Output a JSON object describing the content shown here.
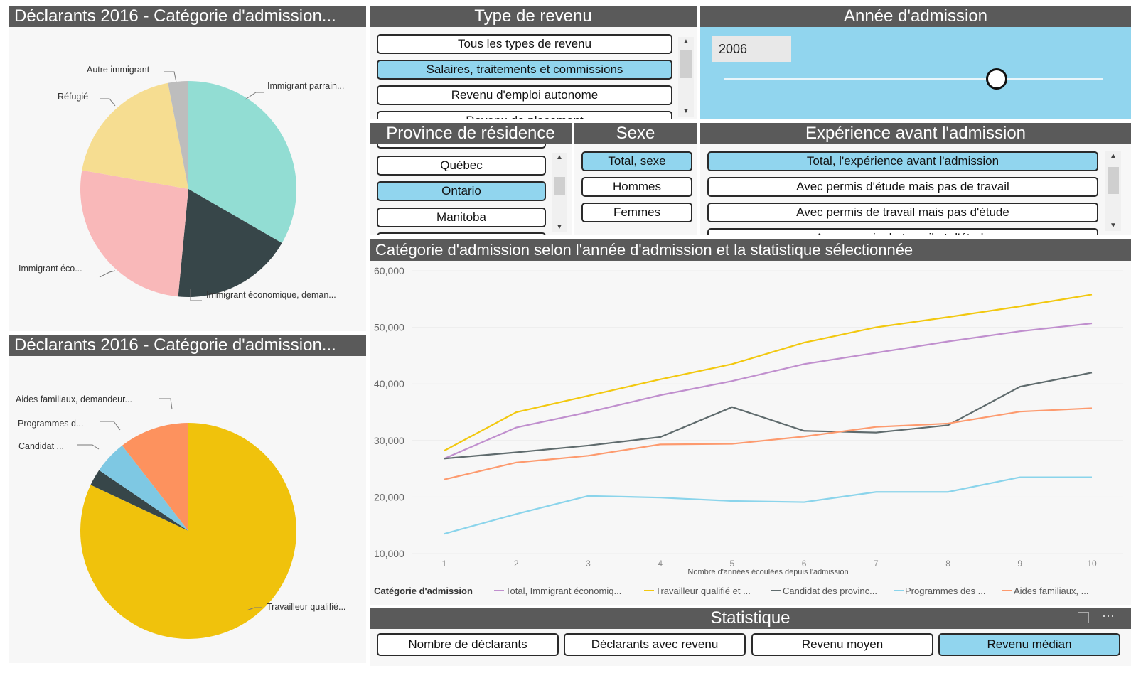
{
  "pie_top": {
    "title": "Déclarants 2016 - Catégorie d'admission...",
    "labels": {
      "autre": "Autre immigrant",
      "refugie": "Réfugié",
      "parraine": "Immigrant parrain...",
      "eco": "Immigrant éco...",
      "eco_dem": "Immigrant économique, deman..."
    }
  },
  "pie_bottom": {
    "title": "Déclarants 2016 - Catégorie d'admission...",
    "labels": {
      "aides": "Aides familiaux, demandeur...",
      "programmes": "Programmes d...",
      "candidat": "Candidat ...",
      "travailleur": "Travailleur qualifié..."
    }
  },
  "type_revenu": {
    "title": "Type de revenu",
    "items": [
      "Tous les types de revenu",
      "Salaires, traitements et commissions",
      "Revenu d'emploi autonome",
      "Revenu de placement"
    ]
  },
  "annee": {
    "title": "Année d'admission",
    "value": "2006",
    "slider_fraction": 0.72
  },
  "province": {
    "title": "Province de résidence",
    "items": [
      "Québec",
      "Ontario",
      "Manitoba"
    ]
  },
  "sexe": {
    "title": "Sexe",
    "items": [
      "Total, sexe",
      "Hommes",
      "Femmes"
    ]
  },
  "experience": {
    "title": "Expérience avant l'admission",
    "items": [
      "Total, l'expérience avant l'admission",
      "Avec permis d'étude mais pas de travail",
      "Avec permis de travail mais pas d'étude",
      "Avec permis de travail et d'étude"
    ]
  },
  "line_chart": {
    "title": "Catégorie d'admission selon l'année d'admission et la statistique sélectionnée",
    "legend_title": "Catégorie d'admission"
  },
  "statistique": {
    "title": "Statistique",
    "buttons": [
      "Nombre de déclarants",
      "Déclarants avec revenu",
      "Revenu moyen",
      "Revenu médian"
    ]
  },
  "colors": {
    "selected": "#91d5ee",
    "title_bar": "#5a5a5a",
    "slider_bg": "#91d5ee"
  },
  "chart_data": [
    {
      "type": "pie",
      "slices": [
        {
          "label": "Immigrant parrain...",
          "value": 33,
          "color": "#92ddd3"
        },
        {
          "label": "Immigrant économique, deman...",
          "value": 18,
          "color": "#374649"
        },
        {
          "label": "Immigrant éco...",
          "value": 26,
          "color": "#f9b8b9"
        },
        {
          "label": "Réfugié",
          "value": 19,
          "color": "#f6dd91"
        },
        {
          "label": "Autre immigrant",
          "value": 3,
          "color": "#bdbdbd"
        }
      ]
    },
    {
      "type": "pie",
      "slices": [
        {
          "label": "Travailleur qualifié...",
          "value": 82,
          "color": "#f0c20c"
        },
        {
          "label": "Candidat ...",
          "value": 2.5,
          "color": "#374649"
        },
        {
          "label": "Programmes d...",
          "value": 5,
          "color": "#7ec8e3"
        },
        {
          "label": "Aides familiaux, demandeur...",
          "value": 10.5,
          "color": "#fd925e"
        }
      ]
    },
    {
      "type": "line",
      "title": "Catégorie d'admission selon l'année d'admission et la statistique sélectionnée",
      "xlabel": "Nombre d'années écoulées depuis l'admission",
      "ylabel": "",
      "x": [
        1,
        2,
        3,
        4,
        5,
        6,
        7,
        8,
        9,
        10
      ],
      "ylim": [
        10000,
        60000
      ],
      "yticks": [
        "10,000",
        "20,000",
        "30,000",
        "40,000",
        "50,000",
        "60,000"
      ],
      "grid": true,
      "legend": "bottom",
      "series": [
        {
          "name": "Total, Immigrant économiq...",
          "color": "#c08fce",
          "values": [
            26800,
            32300,
            35000,
            38000,
            40500,
            43500,
            45500,
            47500,
            49300,
            50700
          ]
        },
        {
          "name": "Travailleur qualifié et ...",
          "color": "#f2c80f",
          "values": [
            28200,
            35000,
            37900,
            40800,
            43500,
            47300,
            50000,
            51800,
            53700,
            55800
          ]
        },
        {
          "name": "Candidat des provinc...",
          "color": "#5f6b6d",
          "values": [
            26800,
            27900,
            29100,
            30600,
            35900,
            31700,
            31400,
            32700,
            39500,
            42000
          ]
        },
        {
          "name": "Programmes des ...",
          "color": "#8ad4eb",
          "values": [
            13500,
            17000,
            20200,
            19900,
            19300,
            19100,
            20900,
            20900,
            23500,
            23500
          ]
        },
        {
          "name": "Aides familiaux, ...",
          "color": "#fd9a6e",
          "values": [
            23100,
            26100,
            27300,
            29300,
            29400,
            30700,
            32400,
            33000,
            35100,
            35700
          ]
        }
      ]
    }
  ]
}
